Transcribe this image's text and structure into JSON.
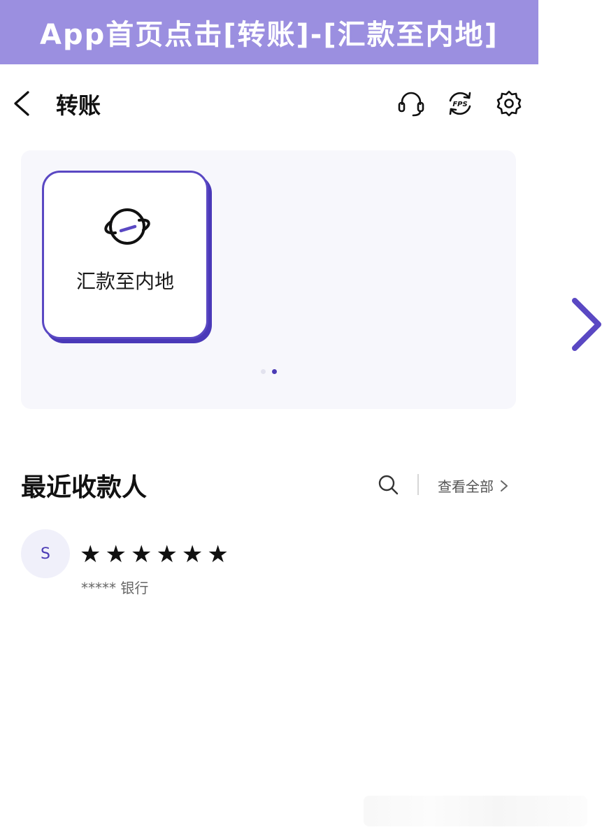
{
  "banner": {
    "text": "App首页点击[转账]-[汇款至内地]"
  },
  "header": {
    "title": "转账",
    "icons": [
      "back-icon",
      "headset-icon",
      "fps-icon",
      "gear-icon"
    ]
  },
  "services": {
    "tiles": [
      {
        "label": "汇款至内地",
        "icon": "planet-icon"
      }
    ],
    "pager": {
      "pages": 2,
      "current": 2
    }
  },
  "recent": {
    "title": "最近收款人",
    "view_all": "查看全部",
    "payees": [
      {
        "avatar": "S",
        "name": "★★★★★★",
        "bank": "***** 银行"
      }
    ]
  },
  "colors": {
    "banner_bg": "#9b8fe0",
    "accent": "#4b3bb5",
    "panel_bg": "#f7f7fc"
  }
}
